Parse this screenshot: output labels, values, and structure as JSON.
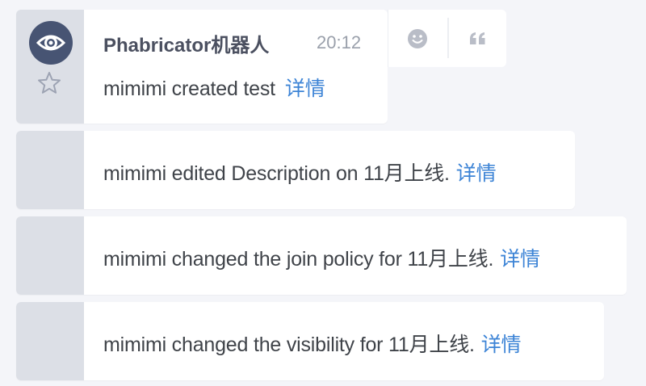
{
  "feed": {
    "header": {
      "sender": "Phabricator机器人",
      "time": "20:12"
    },
    "messages": [
      {
        "text": "mimimi created test",
        "link": "详情"
      },
      {
        "text": "mimimi edited Description on 11月上线.",
        "link": "详情"
      },
      {
        "text": "mimimi changed the join policy for 11月上线.",
        "link": "详情"
      },
      {
        "text": "mimimi changed the visibility for 11月上线.",
        "link": "详情"
      }
    ],
    "actions": [
      {
        "icon": "emoji-smiley-icon"
      },
      {
        "icon": "quote-icon"
      }
    ]
  },
  "colors": {
    "background": "#f4f5f9",
    "gutter": "#dcdfe6",
    "avatar": "#475473",
    "link": "#3d84d6",
    "text": "#3f4349",
    "muted": "#9aa0ab"
  }
}
